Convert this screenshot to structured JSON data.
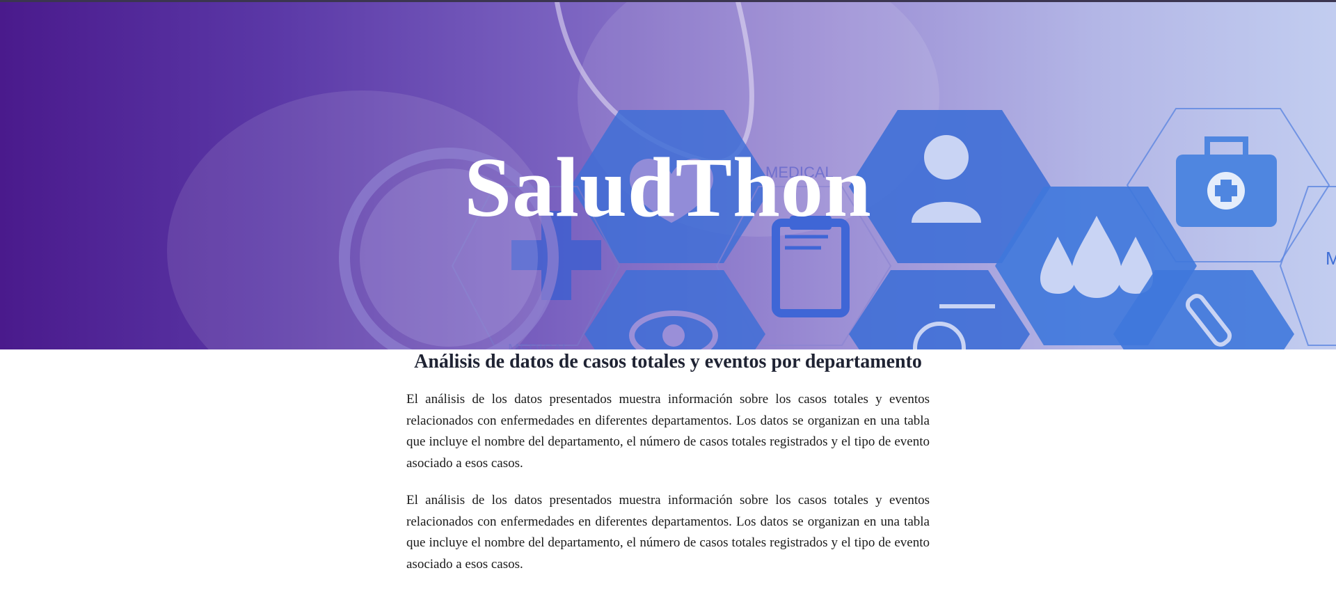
{
  "hero": {
    "title": "SaludThon",
    "background_texts": {
      "medical_1": "MEDICAL",
      "medical_2": "MEDICAL",
      "edge_letter": "M"
    }
  },
  "article": {
    "heading": "Análisis de datos de casos totales y eventos por departamento",
    "paragraphs": [
      "El análisis de los datos presentados muestra información sobre los casos totales y eventos relacionados con enfermedades en diferentes departamentos. Los datos se organizan en una tabla que incluye el nombre del departamento, el número de casos totales registrados y el tipo de evento asociado a esos casos.",
      "El análisis de los datos presentados muestra información sobre los casos totales y eventos relacionados con enfermedades en diferentes departamentos. Los datos se organizan en una tabla que incluye el nombre del departamento, el número de casos totales registrados y el tipo de evento asociado a esos casos."
    ]
  },
  "colors": {
    "hero_gradient_start": "#4a1a8c",
    "hero_gradient_end": "#c2cdf0",
    "hex_fill": "#3f6fd6",
    "title_color": "#ffffff",
    "heading_color": "#1f2333",
    "body_text": "#1a1a1a"
  },
  "icons": [
    "heart-icon",
    "person-icon",
    "medical-kit-icon",
    "plus-cross-icon",
    "clipboard-icon",
    "water-drops-icon",
    "eye-icon",
    "wheelchair-icon",
    "test-tube-icon",
    "stethoscope-icon"
  ]
}
